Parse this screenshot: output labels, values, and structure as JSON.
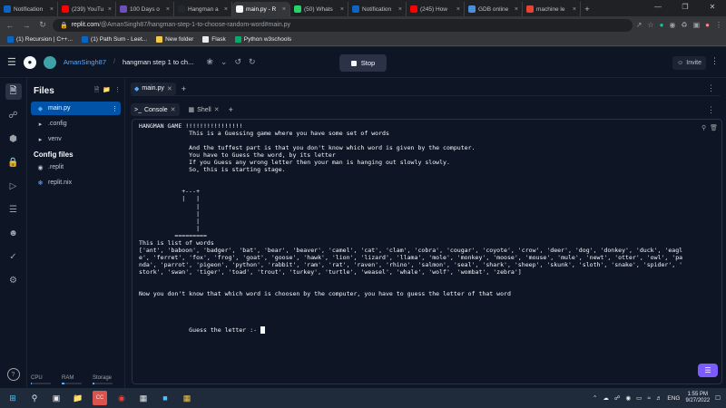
{
  "browser": {
    "tabs": [
      {
        "label": "Notification",
        "icon": "linkedin-icon",
        "color": "#0a66c2"
      },
      {
        "label": "(239) YouTu",
        "icon": "youtube-icon",
        "color": "#ff0000"
      },
      {
        "label": "100 Days o",
        "icon": "site-icon",
        "color": "#6b4fbb"
      },
      {
        "label": "Hangman a",
        "icon": "github-icon",
        "color": "#24292e"
      },
      {
        "label": "main.py - R",
        "icon": "replit-icon",
        "color": "#f5f9fc",
        "active": true
      },
      {
        "label": "(50) Whats",
        "icon": "whatsapp-icon",
        "color": "#25d366"
      },
      {
        "label": "Notification",
        "icon": "linkedin-icon",
        "color": "#0a66c2"
      },
      {
        "label": "(245) How",
        "icon": "youtube-icon",
        "color": "#ff0000"
      },
      {
        "label": "GDB online",
        "icon": "gdb-icon",
        "color": "#4a90d9"
      },
      {
        "label": "machine le",
        "icon": "gmail-icon",
        "color": "#ea4335"
      }
    ],
    "url_host": "replit.com",
    "url_path": "/@AmanSingh87/hangman-step-1-to-choose-random-word#main.py",
    "bookmarks": [
      {
        "label": "(1) Recursion | C++...",
        "color": "#0a66c2"
      },
      {
        "label": "(1) Path Sum - Leet...",
        "color": "#0a66c2"
      },
      {
        "label": "New folder",
        "color": "#f2c94c"
      },
      {
        "label": "Flask",
        "color": "#e8eaed"
      },
      {
        "label": "Python w3schools",
        "color": "#04aa6d"
      }
    ]
  },
  "replit": {
    "username": "AmanSingh87",
    "project": "hangman step 1 to ch...",
    "run_label": "Stop",
    "invite_label": "Invite",
    "files_title": "Files",
    "files": [
      {
        "name": "main.py",
        "icon": "python-file-icon",
        "active": true
      },
      {
        "name": ".config",
        "icon": "folder-icon"
      },
      {
        "name": "venv",
        "icon": "folder-icon"
      }
    ],
    "config_title": "Config files",
    "config_files": [
      {
        "name": ".replit",
        "icon": "replit-config-icon"
      },
      {
        "name": "replit.nix",
        "icon": "nix-icon"
      }
    ],
    "resources": {
      "cpu": "CPU",
      "ram": "RAM",
      "storage": "Storage",
      "cpu_level": 0.05,
      "ram_level": 0.15,
      "storage_level": 0.1
    },
    "editor_tab": "main.py",
    "console_tab": "Console",
    "shell_tab": "Shell",
    "console_output": "HANGMAN GAME !!!!!!!!!!!!!!!!\n              This is a Guessing game where you have some set of words\n\n              And the tuffest part is that you don't know which word is given by the computer.\n              You have to Guess the word, by its letter\n              If you Guess any wrong letter then your man is hanging out slowly slowly.\n              So, this is starting stage.\n\n\n            +---+\n            |   |\n                |\n                |\n                |\n                |\n          =========\nThis is list of words\n['ant', 'baboon', 'badger', 'bat', 'bear', 'beaver', 'camel', 'cat', 'clam', 'cobra', 'cougar', 'coyote', 'crow', 'deer', 'dog', 'donkey', 'duck', 'eagl\ne', 'ferret', 'fox', 'frog', 'goat', 'goose', 'hawk', 'lion', 'lizard', 'llama', 'mole', 'monkey', 'moose', 'mouse', 'mule', 'newt', 'otter', 'owl', 'pa\nnda', 'parrot', 'pigeon', 'python', 'rabbit', 'ram', 'rat', 'raven', 'rhino', 'salmon', 'seal', 'shark', 'sheep', 'skunk', 'sloth', 'snake', 'spider', '\nstork', 'swan', 'tiger', 'toad', 'trout', 'turkey', 'turtle', 'weasel', 'whale', 'wolf', 'wombat', 'zebra']\n\n\nNow you don't know that which word is choosen by the computer, you have to guess the letter of that word\n\n\n\n\n              Guess the letter :- "
  },
  "taskbar": {
    "lang": "ENG",
    "time": "1:55 PM",
    "date": "9/27/2022"
  }
}
